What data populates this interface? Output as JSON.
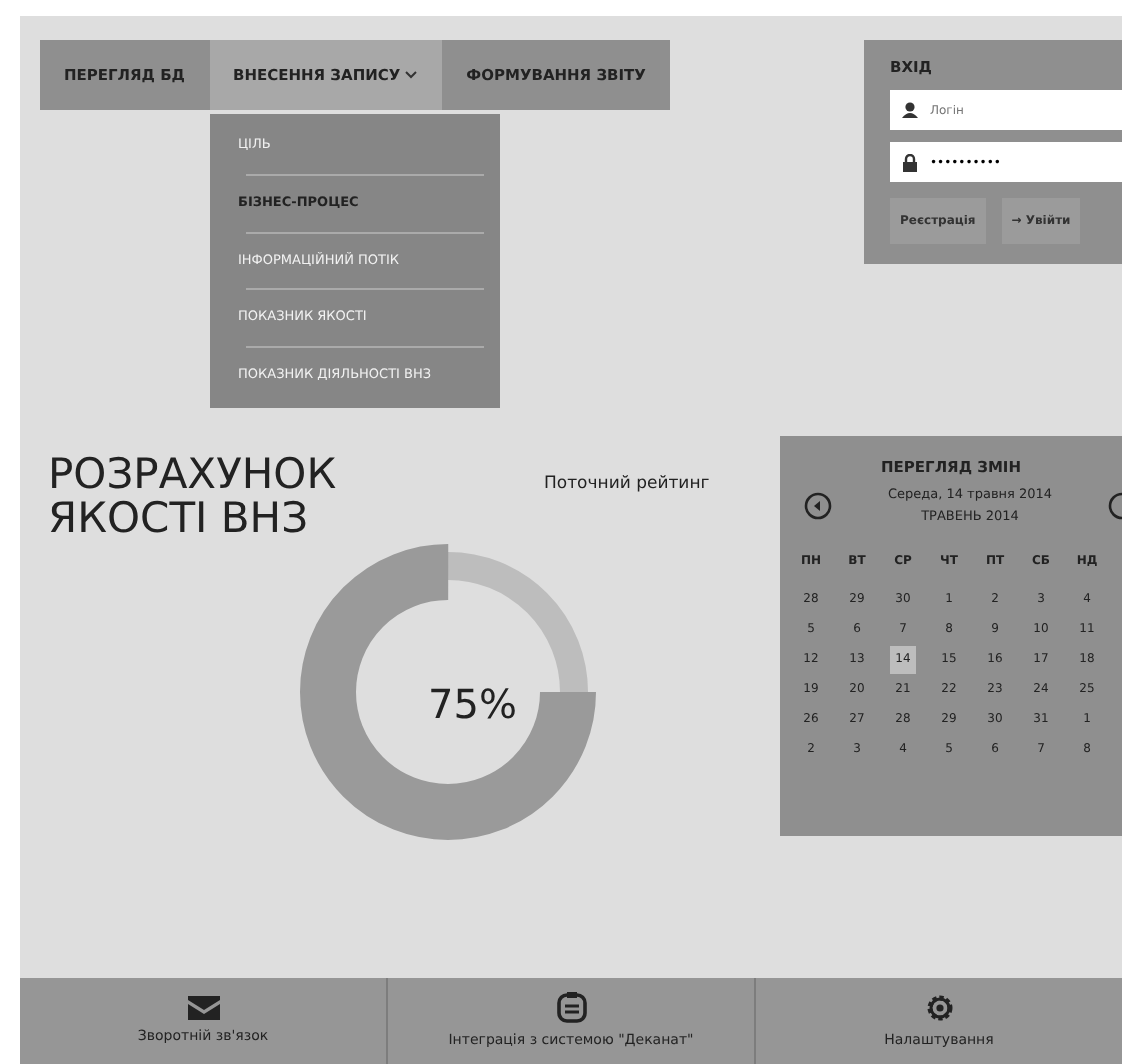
{
  "nav": [
    {
      "label": "ПЕРЕГЛЯД БД",
      "selected": false,
      "expanded": false
    },
    {
      "label": "ВНЕСЕННЯ ЗАПИСУ",
      "selected": true,
      "expanded": true
    },
    {
      "label": "ФОРМУВАННЯ ЗВІТУ",
      "selected": false,
      "expanded": false
    }
  ],
  "dropdown_menu": [
    {
      "label": "ЦІЛЬ",
      "selected": false
    },
    {
      "label": "БІЗНЕС-ПРОЦЕС",
      "selected": true
    },
    {
      "label": "ІНФОРМАЦІЙНИЙ ПОТІК",
      "selected": false
    },
    {
      "label": "ПОКАЗНИК ЯКОСТІ",
      "selected": false
    },
    {
      "label": "ПОКАЗНИК ДІЯЛЬНОСТІ ВНЗ",
      "selected": false
    }
  ],
  "login": {
    "title": "ВХІД",
    "username_placeholder": "Логін",
    "password_value": "••••••••••",
    "buttons": [
      "Реєстрація",
      "→ Увійти"
    ]
  },
  "heading": "РОЗРАХУНОК ЯКОСТІ ВНЗ",
  "rating": {
    "label": "Поточний рейтинг",
    "value": "75%",
    "level": 0.75
  },
  "calendar": {
    "title": "ПЕРЕГЛЯД ЗМІН",
    "date": "Середа, 14 травня 2014",
    "month": "ТРАВЕНЬ 2014",
    "weekdays": [
      "ПН",
      "ВТ",
      "СР",
      "ЧТ",
      "ПТ",
      "СБ",
      "НД"
    ],
    "weeks": [
      [
        {
          "day": "28",
          "selected": false
        },
        {
          "day": "29",
          "selected": false
        },
        {
          "day": "30",
          "selected": false
        },
        {
          "day": "1",
          "selected": false
        },
        {
          "day": "2",
          "selected": false
        },
        {
          "day": "3",
          "selected": false
        },
        {
          "day": "4",
          "selected": false
        }
      ],
      [
        {
          "day": "5",
          "selected": false
        },
        {
          "day": "6",
          "selected": false
        },
        {
          "day": "7",
          "selected": false
        },
        {
          "day": "8",
          "selected": false
        },
        {
          "day": "9",
          "selected": false
        },
        {
          "day": "10",
          "selected": false
        },
        {
          "day": "11",
          "selected": false
        }
      ],
      [
        {
          "day": "12",
          "selected": false
        },
        {
          "day": "13",
          "selected": false
        },
        {
          "day": "14",
          "selected": true
        },
        {
          "day": "15",
          "selected": false
        },
        {
          "day": "16",
          "selected": false
        },
        {
          "day": "17",
          "selected": false
        },
        {
          "day": "18",
          "selected": false
        }
      ],
      [
        {
          "day": "19",
          "selected": false
        },
        {
          "day": "20",
          "selected": false
        },
        {
          "day": "21",
          "selected": false
        },
        {
          "day": "22",
          "selected": false
        },
        {
          "day": "23",
          "selected": false
        },
        {
          "day": "24",
          "selected": false
        },
        {
          "day": "25",
          "selected": false
        }
      ],
      [
        {
          "day": "26",
          "selected": false
        },
        {
          "day": "27",
          "selected": false
        },
        {
          "day": "28",
          "selected": false
        },
        {
          "day": "29",
          "selected": false
        },
        {
          "day": "30",
          "selected": false
        },
        {
          "day": "31",
          "selected": false
        },
        {
          "day": "1",
          "selected": false
        }
      ],
      [
        {
          "day": "2",
          "selected": false
        },
        {
          "day": "3",
          "selected": false
        },
        {
          "day": "4",
          "selected": false
        },
        {
          "day": "5",
          "selected": false
        },
        {
          "day": "6",
          "selected": false
        },
        {
          "day": "7",
          "selected": false
        },
        {
          "day": "8",
          "selected": false
        }
      ]
    ]
  },
  "footer": [
    {
      "kind": "mail",
      "label": "Зворотній зв'язок"
    },
    {
      "kind": "clipboard",
      "label": "Інтеграція з системою \"Деканат\""
    },
    {
      "kind": "settings",
      "label": "Налаштування"
    }
  ]
}
